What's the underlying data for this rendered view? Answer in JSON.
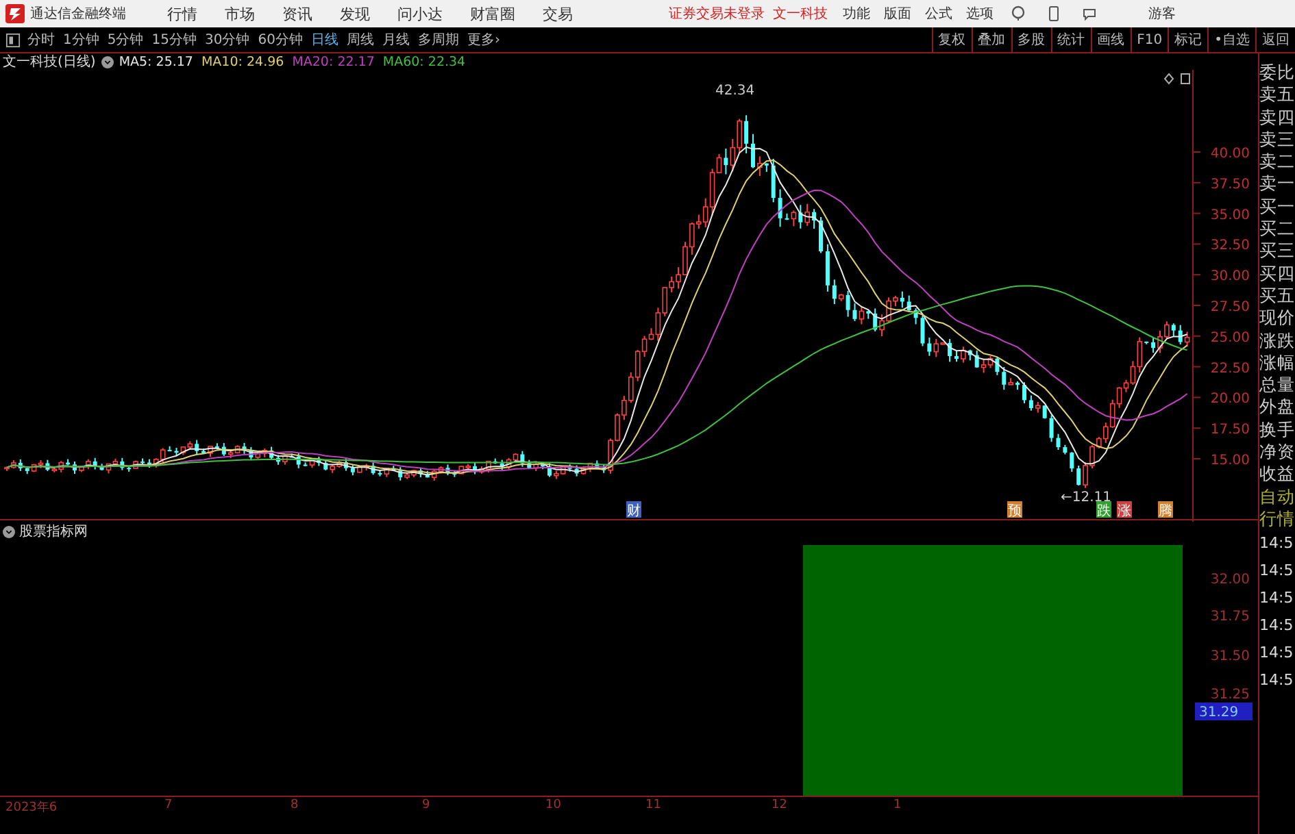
{
  "menubar": {
    "app_title": "通达信金融终端",
    "menus": [
      "行情",
      "市场",
      "资讯",
      "发现",
      "问小达",
      "财富圈",
      "交易"
    ],
    "login_status": "证券交易未登录",
    "stock_name": "文一科技",
    "right_menus": [
      "功能",
      "版面",
      "公式",
      "选项"
    ],
    "user": "游客"
  },
  "toolbar": {
    "periods": [
      {
        "label": "分时",
        "selected": false
      },
      {
        "label": "1分钟",
        "selected": false
      },
      {
        "label": "5分钟",
        "selected": false
      },
      {
        "label": "15分钟",
        "selected": false
      },
      {
        "label": "30分钟",
        "selected": false
      },
      {
        "label": "60分钟",
        "selected": false
      },
      {
        "label": "日线",
        "selected": true
      },
      {
        "label": "周线",
        "selected": false
      },
      {
        "label": "月线",
        "selected": false
      },
      {
        "label": "多周期",
        "selected": false
      },
      {
        "label": "更多›",
        "selected": false
      }
    ],
    "actions": [
      "复权",
      "叠加",
      "多股",
      "统计",
      "画线",
      "F10",
      "标记",
      "•自选",
      "返回"
    ]
  },
  "legend": {
    "title": "文一科技(日线)",
    "averages": [
      {
        "label": "MA5: 25.17",
        "color": "#e8e8e8"
      },
      {
        "label": "MA10: 24.96",
        "color": "#e0d070"
      },
      {
        "label": "MA20: 22.17",
        "color": "#c040c0"
      },
      {
        "label": "MA60: 22.34",
        "color": "#40c040"
      }
    ]
  },
  "main_chart": {
    "high_label": "42.34",
    "low_label": "←12.11",
    "price_ticks": [
      "40.00",
      "37.50",
      "35.00",
      "32.50",
      "30.00",
      "27.50",
      "25.00",
      "22.50",
      "20.00",
      "17.50",
      "15.00"
    ],
    "markers": [
      {
        "text": "财",
        "color": "#4060c0"
      },
      {
        "text": "预",
        "color": "#d08030"
      },
      {
        "text": "跌",
        "color": "#30a030"
      },
      {
        "text": "涨",
        "color": "#d04040"
      },
      {
        "text": "腾",
        "color": "#d08030"
      }
    ]
  },
  "indicator": {
    "title": "股票指标网",
    "ticks": [
      "32.00",
      "31.75",
      "31.50",
      "31.25"
    ],
    "current": "31.29"
  },
  "x_axis": [
    "2023年6",
    "7",
    "8",
    "9",
    "10",
    "11",
    "12",
    "1"
  ],
  "quote_panel": {
    "labels": [
      "委比",
      "卖五",
      "卖四",
      "卖三",
      "卖二",
      "卖一",
      "买一",
      "买二",
      "买三",
      "买四",
      "买五",
      "现价",
      "涨跌",
      "涨幅",
      "总量",
      "外盘",
      "换手",
      "净资",
      "收益"
    ],
    "lower_labels": [
      "自动",
      "行情"
    ],
    "times": [
      "14:5",
      "14:5",
      "14:5",
      "14:5",
      "14:5",
      "14:5"
    ]
  }
}
